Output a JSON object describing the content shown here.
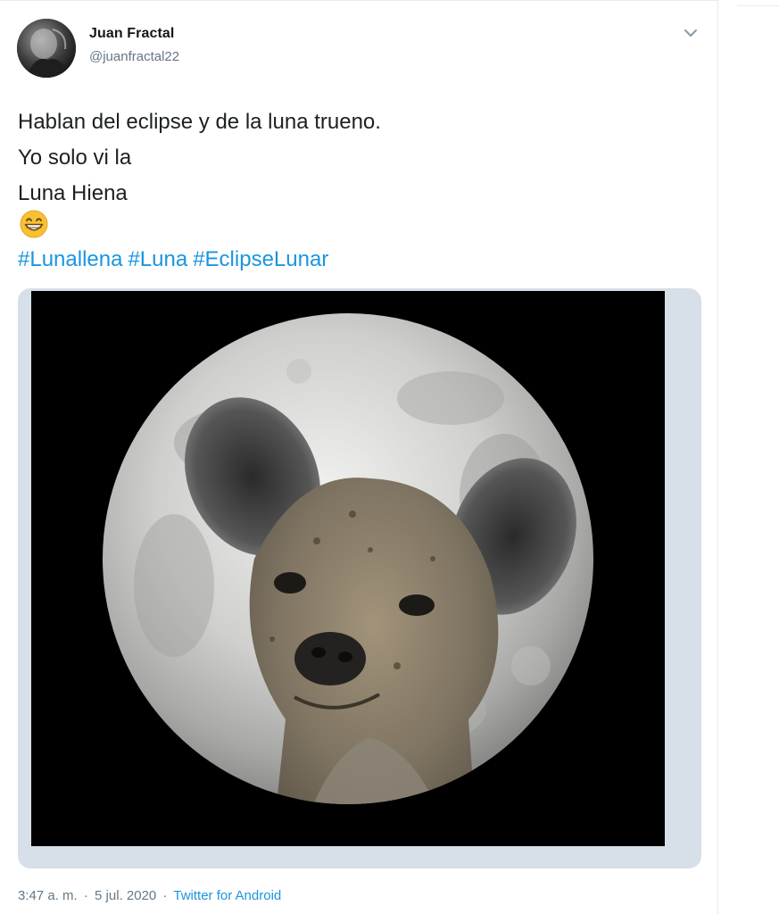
{
  "author": {
    "display_name": "Juan Fractal",
    "handle": "@juanfractal22"
  },
  "menu_icon": "chevron-down-icon",
  "tweet": {
    "lines": [
      "Hablan del eclipse y de la luna trueno.",
      "Yo solo vi la",
      "Luna Hiena"
    ],
    "emoji": "😁",
    "hashtags": [
      "#Lunallena",
      "#Luna",
      "#EclipseLunar"
    ]
  },
  "media": {
    "description_icon": "hyena-moon-photo"
  },
  "meta": {
    "time": "3:47 a. m.",
    "separator": "·",
    "date": "5 jul. 2020",
    "source": "Twitter for Android"
  },
  "colors": {
    "link": "#1b95e0",
    "text": "#1c2022",
    "secondary": "#657786"
  }
}
